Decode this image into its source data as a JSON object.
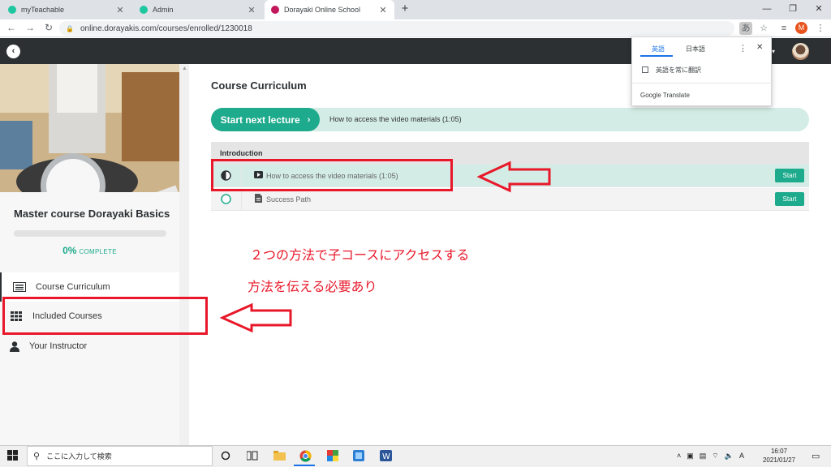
{
  "browser": {
    "tabs": [
      {
        "title": "myTeachable",
        "active": false
      },
      {
        "title": "Admin",
        "active": false
      },
      {
        "title": "Dorayaki Online School",
        "active": true
      }
    ],
    "url": "online.dorayakis.com/courses/enrolled/1230018",
    "profile_initial": "M"
  },
  "sidebar": {
    "course_title": "Master course Dorayaki Basics",
    "progress_percent": "0%",
    "progress_label": "COMPLETE",
    "progress_value": 0,
    "nav": [
      {
        "label": "Course Curriculum",
        "icon": "curriculum-icon",
        "active": true
      },
      {
        "label": "Included Courses",
        "icon": "grid-icon",
        "active": false
      },
      {
        "label": "Your Instructor",
        "icon": "person-icon",
        "active": false
      }
    ]
  },
  "main": {
    "heading": "Course Curriculum",
    "next_button_label": "Start next lecture",
    "next_lecture": "How to access the video materials (1:05)",
    "section_title": "Introduction",
    "lectures": [
      {
        "title": "How to access the video materials (1:05)",
        "type_icon": "video-icon",
        "status": "half",
        "button": "Start"
      },
      {
        "title": "Success Path",
        "type_icon": "document-icon",
        "status": "empty",
        "button": "Start"
      }
    ]
  },
  "annotations": {
    "note_line1": "２つの方法で子コースにアクセスする",
    "note_line2": "方法を伝える必要あり",
    "color": "#e8182a"
  },
  "translate_popup": {
    "lang_selected": "英語",
    "lang_other": "日本語",
    "always_translate": "英語を常に翻訳",
    "brand": "Google Translate"
  },
  "taskbar": {
    "search_placeholder": "ここに入力して検索",
    "time": "16:07",
    "date": "2021/01/27"
  },
  "colors": {
    "accent": "#1eaa8c",
    "header": "#2c3033"
  }
}
